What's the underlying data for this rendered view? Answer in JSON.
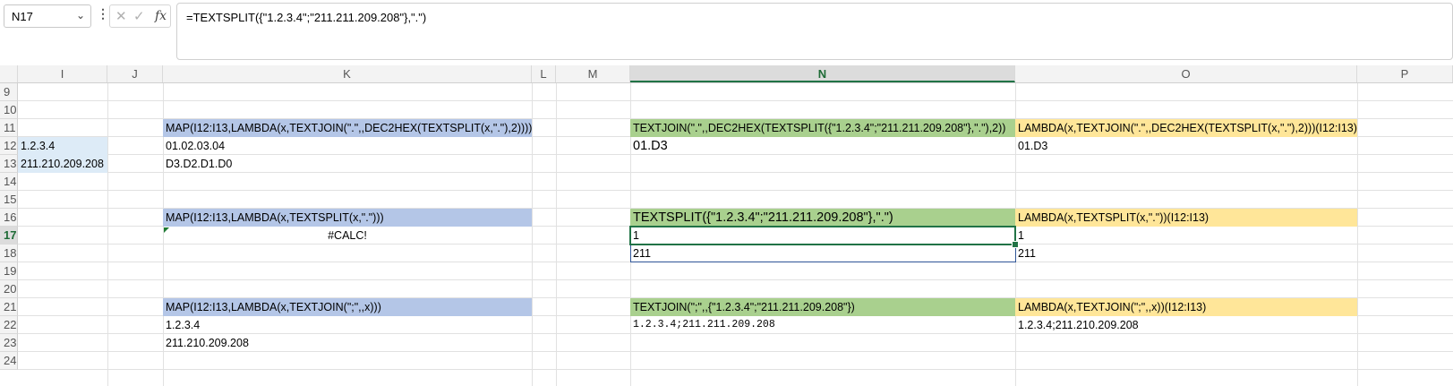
{
  "formula_bar": {
    "name_box": "N17",
    "formula": "=TEXTSPLIT({\"1.2.3.4\";\"211.211.209.208\"},\".\")",
    "fx_label": "fx",
    "more_glyph": "⋮",
    "cancel_glyph": "✕",
    "enter_glyph": "✓",
    "dropdown_glyph": "⌄"
  },
  "columns": [
    "I",
    "J",
    "K",
    "L",
    "M",
    "N",
    "O",
    "P"
  ],
  "rows": [
    "9",
    "10",
    "11",
    "12",
    "13",
    "14",
    "15",
    "16",
    "17",
    "18",
    "19",
    "20",
    "21",
    "22",
    "23",
    "24"
  ],
  "cells": {
    "I12": "1.2.3.4",
    "I13": "211.210.209.208",
    "K11": "MAP(I12:I13,LAMBDA(x,TEXTJOIN(\".\",,DEC2HEX(TEXTSPLIT(x,\".\"),2))))",
    "K12": "01.02.03.04",
    "K13": "D3.D2.D1.D0",
    "K16": "MAP(I12:I13,LAMBDA(x,TEXTSPLIT(x,\".\")))",
    "K17": "#CALC!",
    "K21": "MAP(I12:I13,LAMBDA(x,TEXTJOIN(\";\",,x)))",
    "K22": "1.2.3.4",
    "K23": "211.210.209.208",
    "N11": "TEXTJOIN(\".\",,DEC2HEX(TEXTSPLIT({\"1.2.3.4\";\"211.211.209.208\"},\".\"),2))",
    "N12": "01.D3",
    "N16": "TEXTSPLIT({\"1.2.3.4\";\"211.211.209.208\"},\".\")",
    "N17": "1",
    "N18": "211",
    "N21": "TEXTJOIN(\";\",,{\"1.2.3.4\";\"211.211.209.208\"})",
    "N22": "1.2.3.4;211.211.209.208",
    "O11": "LAMBDA(x,TEXTJOIN(\".\",,DEC2HEX(TEXTSPLIT(x,\".\"),2)))(I12:I13)",
    "O12": "01.D3",
    "O16": "LAMBDA(x,TEXTSPLIT(x,\".\"))(I12:I13)",
    "O17": "1",
    "O18": "211",
    "O21": "LAMBDA(x,TEXTJOIN(\";\",,x))(I12:I13)",
    "O22": "1.2.3.4;211.210.209.208"
  },
  "colors": {
    "header_blue": "#b4c6e7",
    "input_lightblue": "#ddebf7",
    "header_green": "#a9d08e",
    "header_yellow": "#ffe699",
    "selection_green": "#217346"
  }
}
